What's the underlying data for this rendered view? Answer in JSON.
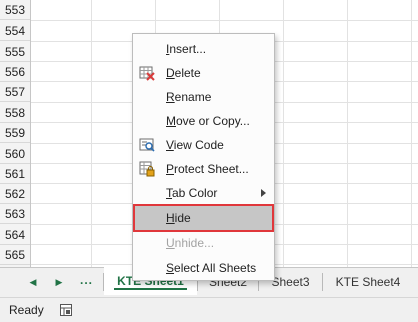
{
  "grid": {
    "row_numbers": [
      "553",
      "554",
      "555",
      "556",
      "557",
      "558",
      "559",
      "560",
      "561",
      "562",
      "563",
      "564",
      "565"
    ]
  },
  "context_menu": {
    "items": [
      {
        "key": "insert",
        "label": "Insert...",
        "mnemonic": "I",
        "enabled": true,
        "icon": ""
      },
      {
        "key": "delete",
        "label": "Delete",
        "mnemonic": "D",
        "enabled": true,
        "icon": "delete-sheet-icon"
      },
      {
        "key": "rename",
        "label": "Rename",
        "mnemonic": "R",
        "enabled": true,
        "icon": ""
      },
      {
        "key": "move_copy",
        "label": "Move or Copy...",
        "mnemonic": "M",
        "enabled": true,
        "icon": ""
      },
      {
        "key": "view_code",
        "label": "View Code",
        "mnemonic": "V",
        "enabled": true,
        "icon": "view-code-icon"
      },
      {
        "key": "protect",
        "label": "Protect Sheet...",
        "mnemonic": "P",
        "enabled": true,
        "icon": "protect-sheet-icon"
      },
      {
        "key": "tab_color",
        "label": "Tab Color",
        "mnemonic": "T",
        "enabled": true,
        "icon": "",
        "submenu": true
      },
      {
        "key": "hide",
        "label": "Hide",
        "mnemonic": "H",
        "enabled": true,
        "icon": "",
        "highlighted": true
      },
      {
        "key": "unhide",
        "label": "Unhide...",
        "mnemonic": "U",
        "enabled": false,
        "icon": ""
      },
      {
        "key": "select_all",
        "label": "Select All Sheets",
        "mnemonic": "S",
        "enabled": true,
        "icon": ""
      }
    ]
  },
  "tabs": {
    "sheets": [
      {
        "label": "KTE Sheet1",
        "active": true
      },
      {
        "label": "Sheet2",
        "active": false
      },
      {
        "label": "Sheet3",
        "active": false
      },
      {
        "label": "KTE Sheet4",
        "active": false
      }
    ],
    "nav_prev": "◀",
    "nav_next": "▶",
    "more": "..."
  },
  "status": {
    "text": "Ready"
  },
  "colors": {
    "accent": "#217346",
    "highlight_border": "#e0373b"
  }
}
